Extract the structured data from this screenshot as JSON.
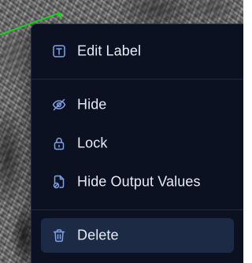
{
  "colors": {
    "menu_bg": "#0b1120",
    "menu_border": "#1e2a40",
    "active_bg": "#1c2a46",
    "icon_color": "#7fa2e6",
    "text_color": "#e6ebf5",
    "annotation_line": "#1fd11f"
  },
  "context_menu": {
    "items": [
      {
        "label": "Edit Label",
        "icon": "text-box-icon"
      },
      {
        "label": "Hide",
        "icon": "eye-off-icon"
      },
      {
        "label": "Lock",
        "icon": "lock-icon"
      },
      {
        "label": "Hide Output Values",
        "icon": "file-off-icon"
      },
      {
        "label": "Delete",
        "icon": "trash-icon",
        "active": true
      }
    ]
  }
}
